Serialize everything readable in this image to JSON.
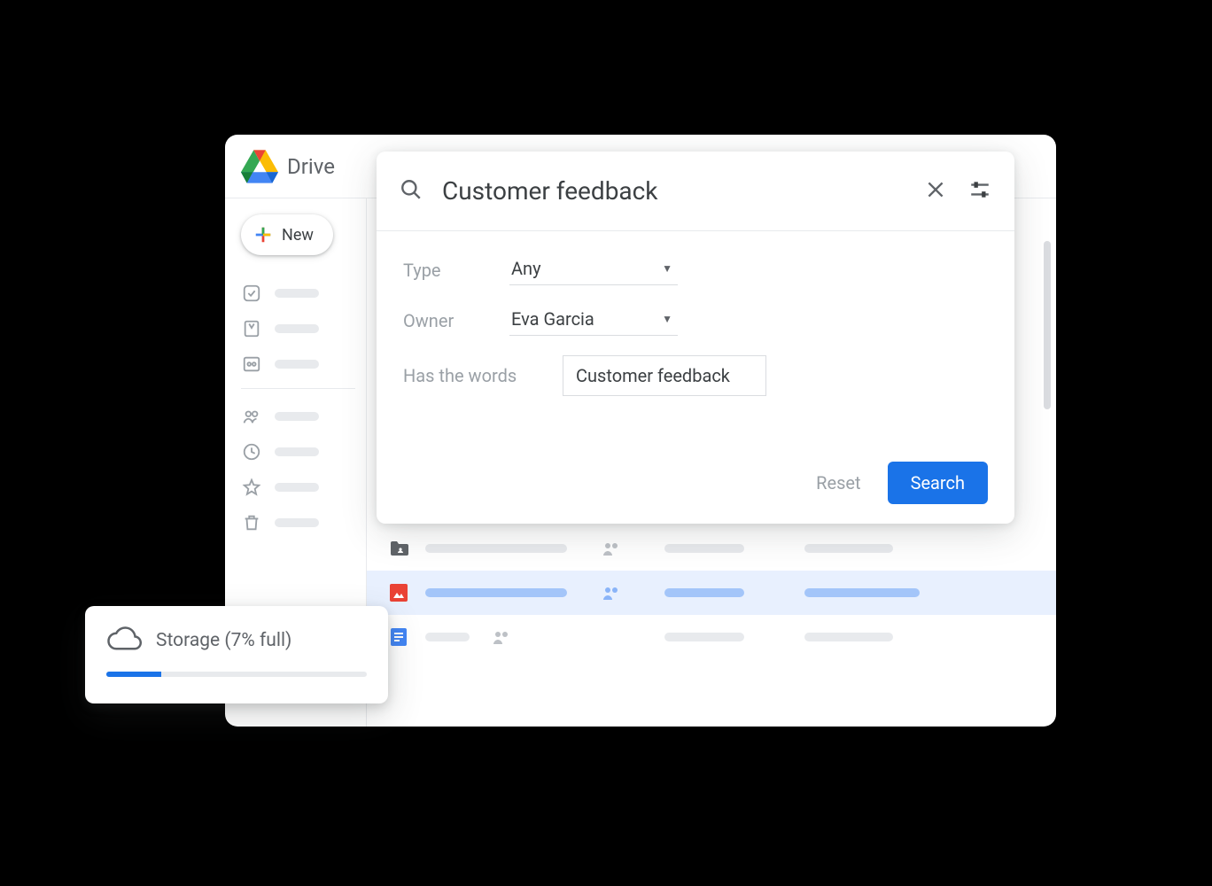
{
  "app": {
    "name": "Drive"
  },
  "sidebar": {
    "new_label": "New"
  },
  "search": {
    "query": "Customer feedback",
    "filters": {
      "type_label": "Type",
      "type_value": "Any",
      "owner_label": "Owner",
      "owner_value": "Eva Garcia",
      "words_label": "Has the words",
      "words_value": "Customer feedback"
    },
    "reset_label": "Reset",
    "search_label": "Search"
  },
  "storage": {
    "label": "Storage (7% full)",
    "percent": 7
  }
}
